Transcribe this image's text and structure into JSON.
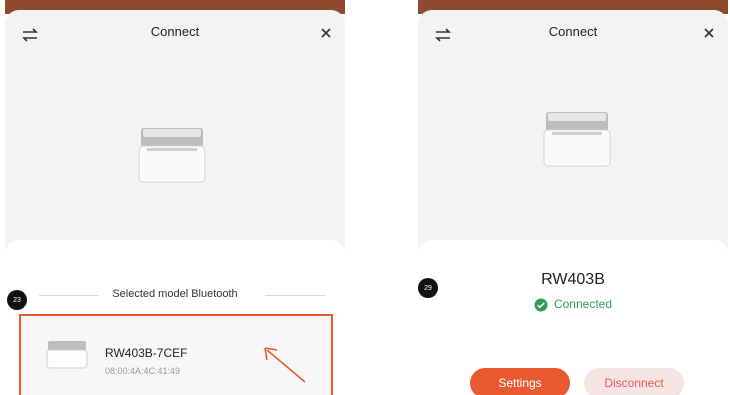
{
  "left_screen": {
    "header": {
      "title": "Connect"
    },
    "step_badge": "23",
    "section_label": "Selected model Bluetooth",
    "device": {
      "name": "RW403B-7CEF",
      "mac": "08:00:4A:4C:41:49"
    }
  },
  "right_screen": {
    "header": {
      "title": "Connect"
    },
    "step_badge": "29",
    "device_name": "RW403B",
    "status": "Connected",
    "buttons": {
      "settings": "Settings",
      "disconnect": "Disconnect"
    }
  },
  "colors": {
    "accent": "#ea5a32",
    "success": "#2f9e5a",
    "disconnect_text": "#e25b52",
    "disconnect_bg": "#f6e4e4"
  },
  "icons": [
    "swap-icon",
    "close-icon",
    "printer-icon",
    "check-circle-icon",
    "arrow-icon"
  ]
}
